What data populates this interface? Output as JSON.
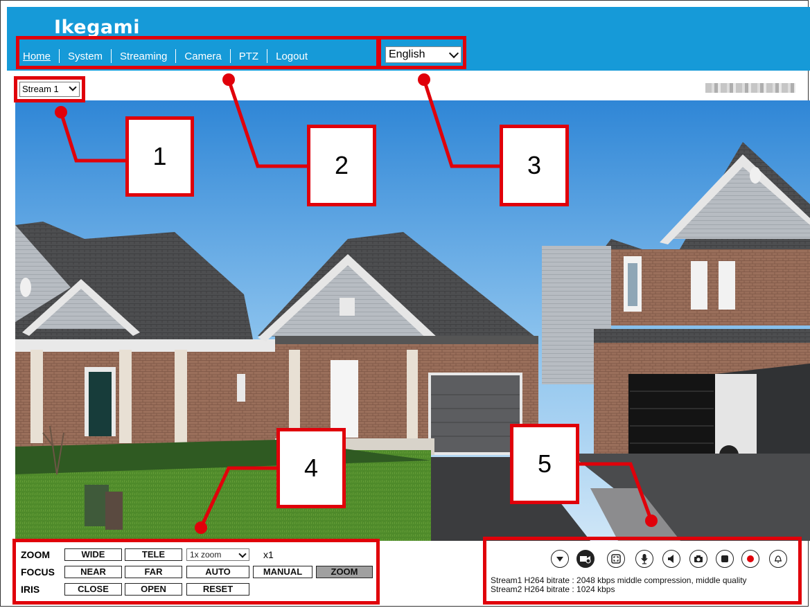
{
  "brand": "Ikegami",
  "nav": [
    "Home",
    "System",
    "Streaming",
    "Camera",
    "PTZ",
    "Logout"
  ],
  "language": "English",
  "stream_select": "Stream 1",
  "callouts": [
    "1",
    "2",
    "3",
    "4",
    "5"
  ],
  "ptz": {
    "zoom": {
      "label": "ZOOM",
      "wide": "WIDE",
      "tele": "TELE",
      "zoom_select": "1x zoom",
      "zoom_value": "x1"
    },
    "focus": {
      "label": "FOCUS",
      "near": "NEAR",
      "far": "FAR",
      "auto": "AUTO",
      "manual": "MANUAL",
      "zoom": "ZOOM"
    },
    "iris": {
      "label": "IRIS",
      "close": "CLOSE",
      "open": "OPEN",
      "reset": "RESET"
    }
  },
  "tool_icons": [
    "dropdown-icon",
    "zoom-camera-icon",
    "fullscreen-icon",
    "microphone-icon",
    "speaker-icon",
    "snapshot-icon",
    "stop-icon",
    "record-icon",
    "alarm-bell-icon"
  ],
  "stream_info": {
    "line1": "Stream1 H264 bitrate : 2048 kbps middle compression, middle quality",
    "line2": "Stream2 H264 bitrate : 1024 kbps"
  },
  "colors": {
    "header": "#169ad8",
    "annotation": "#e0000a",
    "active_button": "#a0a0a0"
  }
}
